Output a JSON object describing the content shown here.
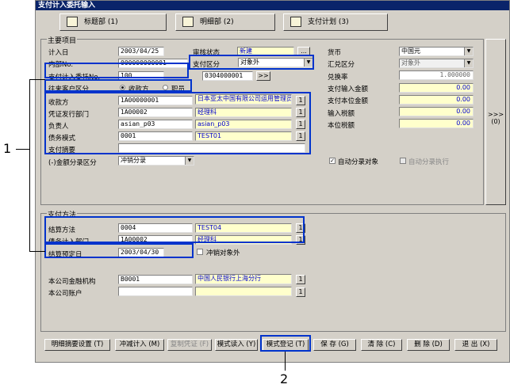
{
  "window_title": "支付计入委托输入",
  "tabs": [
    {
      "label": "标题部 (1)"
    },
    {
      "label": "明细部 (2)"
    },
    {
      "label": "支付计划 (3)"
    }
  ],
  "main_group": {
    "title": "主要项目"
  },
  "fields": {
    "entry_date": {
      "label": "计入日",
      "value": "2003/04/25"
    },
    "internal_no": {
      "label": "内部No.",
      "value": "000000000001"
    },
    "entrust_no": {
      "label": "支付计入委托No.",
      "value": "100"
    },
    "audit_status": {
      "label": "审核状态",
      "value": "新建",
      "btn": "..."
    },
    "payment_category": {
      "label": "支付区分",
      "value": "对象外"
    },
    "account_no": {
      "value": "0304000001",
      "btn": ">>"
    },
    "counterparty_type": {
      "label": "往来客户区分",
      "opt1": "收款方",
      "opt2": "职员"
    },
    "payee": {
      "label": "收款方",
      "code": "1A00000001",
      "name": "日本亚太中国有限公司运用管理员员"
    },
    "voucher_dept": {
      "label": "凭证发行部门",
      "code": "1A00002",
      "name": "经理科"
    },
    "person": {
      "label": "负责人",
      "code": "asian_p03",
      "name": "asian_p03"
    },
    "debt_mode": {
      "label": "债务模式",
      "code": "0001",
      "name": "TEST01"
    },
    "payment_summary": {
      "label": "支付摘要"
    },
    "amount_split": {
      "label": "(-)金额分录区分",
      "value": "冲销分录"
    },
    "currency": {
      "label": "货币",
      "value": "中国元"
    },
    "exchange_category": {
      "label": "汇兑区分",
      "value": "对象外"
    },
    "exchange_rate": {
      "label": "兑换率",
      "value": "1.000000"
    },
    "pay_input_amount": {
      "label": "支付输入金额",
      "value": "0.00"
    },
    "pay_local_amount": {
      "label": "支付本位金额",
      "value": "0.00"
    },
    "input_tax": {
      "label": "输入税额",
      "value": "0.00"
    },
    "local_tax": {
      "label": "本位税额",
      "value": "0.00"
    },
    "auto_split": {
      "label": "自动分录对象"
    },
    "auto_split_exec": {
      "label": "自动分录执行"
    }
  },
  "side_button": {
    "label": ">>>",
    "key": "(0)"
  },
  "pay_group": {
    "title": "支付方法"
  },
  "pay_fields": {
    "settle_method": {
      "label": "结算方法",
      "code": "0004",
      "name": "TEST04"
    },
    "debt_dept": {
      "label": "债务计入部门",
      "code": "1A00002",
      "name": "经理科"
    },
    "settle_date": {
      "label": "结算预定日",
      "value": "2003/04/30"
    },
    "offset_exclude": {
      "label": "冲销对象外"
    },
    "bank": {
      "label": "本公司金融机构",
      "code": "B0001",
      "name": "中国人民银行上海分行"
    },
    "bank_account": {
      "label": "本公司账户"
    }
  },
  "small_btn": "1",
  "buttons": [
    {
      "label": "明细摘要设置 (T)"
    },
    {
      "label": "冲减计入 (M)"
    },
    {
      "label": "复制凭证 (F)"
    },
    {
      "label": "模式读入 (Y)"
    },
    {
      "label": "模式登记 (T)"
    },
    {
      "label": "保 存 (G)"
    },
    {
      "label": "清 除 (C)"
    },
    {
      "label": "删 除 (D)"
    },
    {
      "label": "退 出 (X)"
    }
  ],
  "callouts": [
    "1",
    "2"
  ]
}
